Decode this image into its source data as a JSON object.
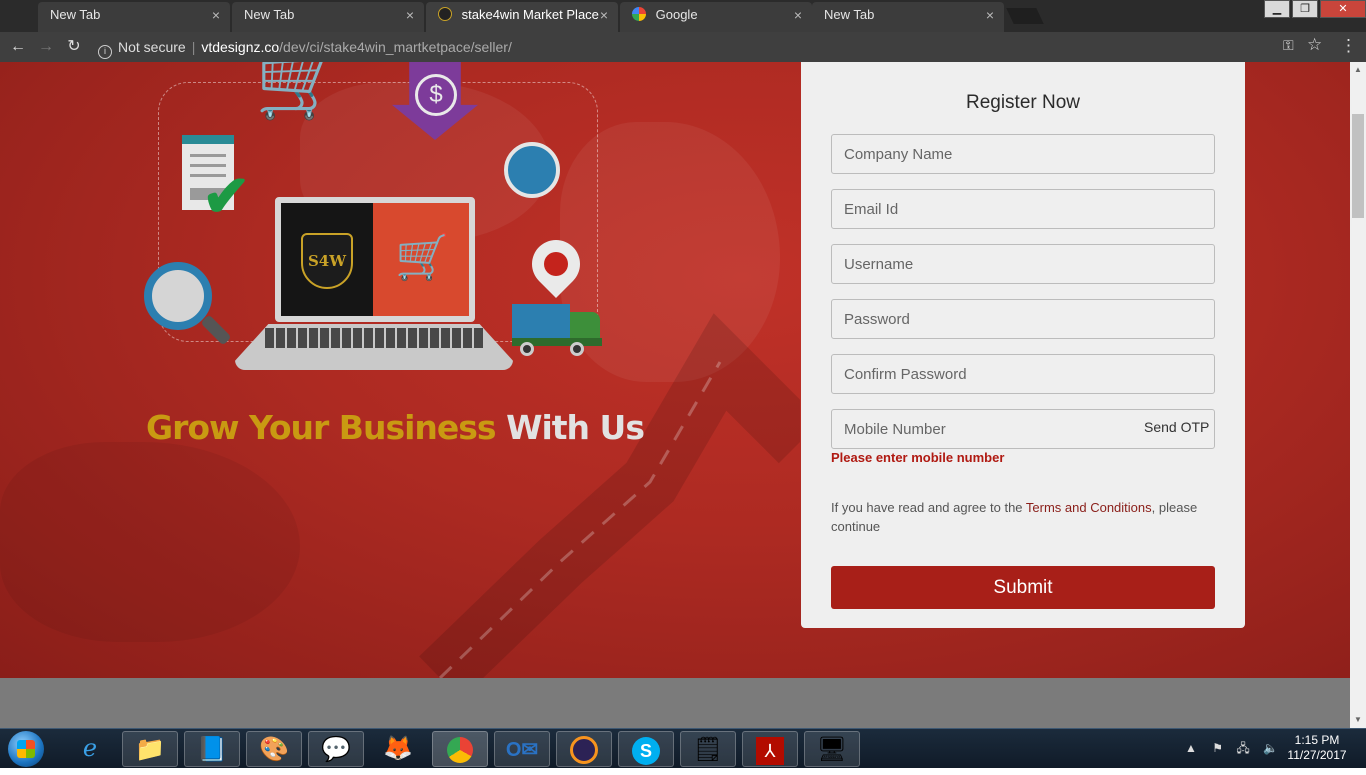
{
  "browser": {
    "tabs": [
      {
        "title": "New Tab"
      },
      {
        "title": "New Tab"
      },
      {
        "title": "stake4win Market Place"
      },
      {
        "title": "Google"
      },
      {
        "title": "New Tab"
      }
    ],
    "close_glyph": "×",
    "omnibox": {
      "security_label": "Not secure",
      "host": "vtdesignz.co",
      "path": "/dev/ci/stake4win_martketpace/seller/"
    }
  },
  "hero": {
    "tagline_gold": "Grow Your Business",
    "tagline_light": "With Us",
    "logo_text": "S4W"
  },
  "register": {
    "title": "Register Now",
    "fields": {
      "company_name": "Company Name",
      "email_id": "Email Id",
      "username": "Username",
      "password": "Password",
      "confirm_password": "Confirm Password",
      "mobile_number": "Mobile Number"
    },
    "send_otp": "Send OTP",
    "error": "Please enter mobile number",
    "terms_prefix": "If you have read and agree to the ",
    "terms_link": "Terms and Conditions",
    "terms_suffix": ", please continue",
    "submit": "Submit"
  },
  "taskbar": {
    "time": "1:15 PM",
    "date": "11/27/2017"
  },
  "colors": {
    "hero_red": "#ad2a22",
    "accent_gold": "#c99a12",
    "submit_red": "#a81f18",
    "error_red": "#b01a12"
  }
}
